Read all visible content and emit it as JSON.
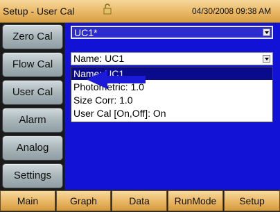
{
  "header": {
    "title": "Setup - User Cal",
    "datetime": "04/30/2008 09:38 AM",
    "lock_icon": "lock-icon"
  },
  "sidebar": {
    "items": [
      {
        "label": "Zero Cal"
      },
      {
        "label": "Flow Cal"
      },
      {
        "label": "User Cal"
      },
      {
        "label": "Alarm"
      },
      {
        "label": "Analog"
      },
      {
        "label": "Settings"
      }
    ]
  },
  "main": {
    "cal_select": {
      "value": "UC1*"
    },
    "param_select": {
      "value": "Name: UC1"
    },
    "param_options": [
      {
        "label": "Name: UC1",
        "selected": true
      },
      {
        "label": "Photometric: 1.0",
        "selected": false
      },
      {
        "label": "Size Corr: 1.0",
        "selected": false
      },
      {
        "label": "User Cal [On,Off]: On",
        "selected": false
      }
    ],
    "annotation_icon": "arrow-left-icon",
    "colors": {
      "panel": "#1212d6",
      "selection": "#0a0a8c",
      "annotation": "#1a1ad8"
    }
  },
  "bottom_nav": {
    "items": [
      {
        "label": "Main"
      },
      {
        "label": "Graph"
      },
      {
        "label": "Data"
      },
      {
        "label": "RunMode"
      },
      {
        "label": "Setup"
      }
    ]
  }
}
